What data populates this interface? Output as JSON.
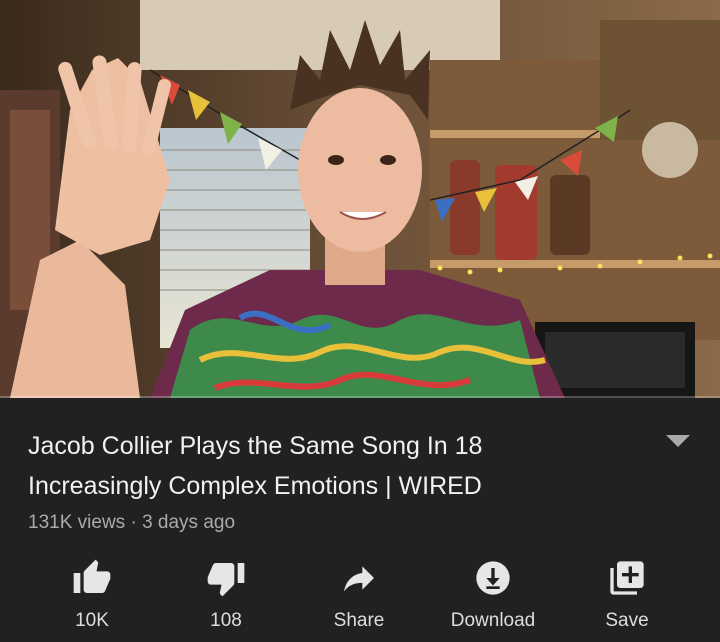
{
  "video": {
    "title_line1": "Jacob Collier Plays the Same Song In 18",
    "title_line2": "Increasingly Complex Emotions | WIRED",
    "views": "131K views",
    "separator": "·",
    "age": "3 days ago",
    "progress_fraction": 0.0
  },
  "actions": {
    "like_label": "10K",
    "dislike_label": "108",
    "share_label": "Share",
    "download_label": "Download",
    "save_label": "Save"
  },
  "colors": {
    "background": "#212121",
    "title": "#f1f1f1",
    "meta": "#aaaaaa",
    "icon": "#e6e6e6",
    "progress": "#ff0000"
  }
}
